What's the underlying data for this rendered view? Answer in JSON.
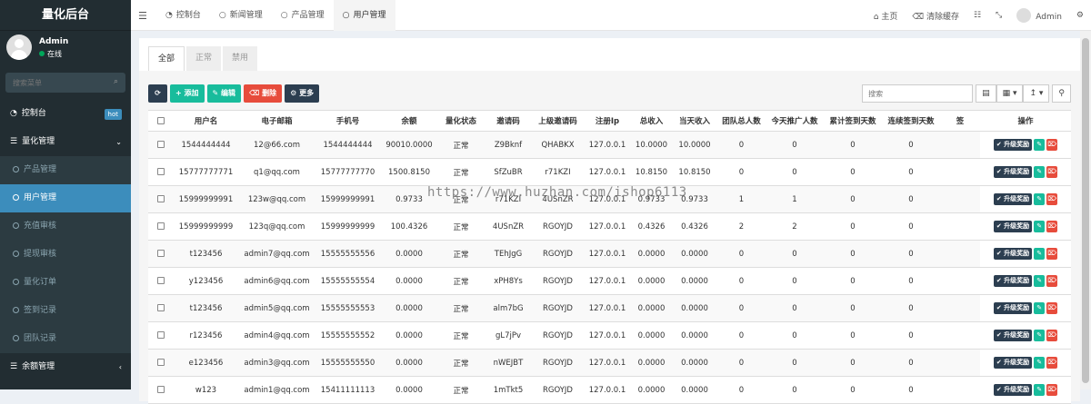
{
  "sidebar": {
    "title": "量化后台",
    "user": {
      "name": "Admin",
      "status": "在线"
    },
    "search_placeholder": "搜索菜单",
    "items": [
      {
        "label": "控制台",
        "badge": "hot",
        "type": "top"
      },
      {
        "label": "量化管理",
        "type": "top-open"
      },
      {
        "label": "产品管理",
        "type": "sub"
      },
      {
        "label": "用户管理",
        "type": "sub-active"
      },
      {
        "label": "充值审核",
        "type": "sub"
      },
      {
        "label": "提现审核",
        "type": "sub"
      },
      {
        "label": "量化订单",
        "type": "sub"
      },
      {
        "label": "签到记录",
        "type": "sub"
      },
      {
        "label": "团队记录",
        "type": "sub"
      },
      {
        "label": "余额管理",
        "type": "top"
      }
    ]
  },
  "topbar": {
    "tabs": [
      "控制台",
      "新闻管理",
      "产品管理",
      "用户管理"
    ],
    "right": {
      "home": "主页",
      "clear_cache": "清除缓存",
      "user": "Admin"
    }
  },
  "content_tabs": [
    "全部",
    "正常",
    "禁用"
  ],
  "toolbar": {
    "add": "添加",
    "edit": "编辑",
    "delete": "删除",
    "more": "更多"
  },
  "search_placeholder": "搜索",
  "table": {
    "headers": [
      "用户名",
      "电子邮箱",
      "手机号",
      "余额",
      "量化状态",
      "邀请码",
      "上级邀请码",
      "注册Ip",
      "总收入",
      "当天收入",
      "团队总人数",
      "今天推广人数",
      "累计签到天数",
      "连续签到天数",
      "签",
      "操作"
    ],
    "upgrade_label": "升级奖励",
    "rows": [
      [
        "1544444444",
        "12@66.com",
        "1544444444",
        "90010.0000",
        "正常",
        "Z9Bknf",
        "QHABKX",
        "127.0.0.1",
        "10.0000",
        "10.0000",
        "0",
        "0",
        "0",
        "0"
      ],
      [
        "15777777771",
        "q1@qq.com",
        "15777777770",
        "1500.8150",
        "正常",
        "SfZuBR",
        "r71KZI",
        "127.0.0.1",
        "10.8150",
        "10.8150",
        "0",
        "0",
        "0",
        "0"
      ],
      [
        "15999999991",
        "123w@qq.com",
        "15999999991",
        "0.9733",
        "正常",
        "r71KZI",
        "4USnZR",
        "127.0.0.1",
        "0.9733",
        "0.9733",
        "1",
        "1",
        "0",
        "0"
      ],
      [
        "15999999999",
        "123q@qq.com",
        "15999999999",
        "100.4326",
        "正常",
        "4USnZR",
        "RGOYJD",
        "127.0.0.1",
        "0.4326",
        "0.4326",
        "2",
        "2",
        "0",
        "0"
      ],
      [
        "t123456",
        "admin7@qq.com",
        "15555555556",
        "0.0000",
        "正常",
        "TEhJgG",
        "RGOYJD",
        "127.0.0.1",
        "0.0000",
        "0.0000",
        "0",
        "0",
        "0",
        "0"
      ],
      [
        "y123456",
        "admin6@qq.com",
        "15555555554",
        "0.0000",
        "正常",
        "xPH8Ys",
        "RGOYJD",
        "127.0.0.1",
        "0.0000",
        "0.0000",
        "0",
        "0",
        "0",
        "0"
      ],
      [
        "t123456",
        "admin5@qq.com",
        "15555555553",
        "0.0000",
        "正常",
        "alm7bG",
        "RGOYJD",
        "127.0.0.1",
        "0.0000",
        "0.0000",
        "0",
        "0",
        "0",
        "0"
      ],
      [
        "r123456",
        "admin4@qq.com",
        "15555555552",
        "0.0000",
        "正常",
        "gL7jPv",
        "RGOYJD",
        "127.0.0.1",
        "0.0000",
        "0.0000",
        "0",
        "0",
        "0",
        "0"
      ],
      [
        "e123456",
        "admin3@qq.com",
        "15555555550",
        "0.0000",
        "正常",
        "nWEJBT",
        "RGOYJD",
        "127.0.0.1",
        "0.0000",
        "0.0000",
        "0",
        "0",
        "0",
        "0"
      ],
      [
        "w123",
        "admin1@qq.com",
        "15411111113",
        "0.0000",
        "正常",
        "1mTkt5",
        "RGOYJD",
        "127.0.0.1",
        "0.0000",
        "0.0000",
        "0",
        "0",
        "0",
        "0"
      ]
    ]
  },
  "watermark": "https://www.huzhan.com/ishop6113"
}
